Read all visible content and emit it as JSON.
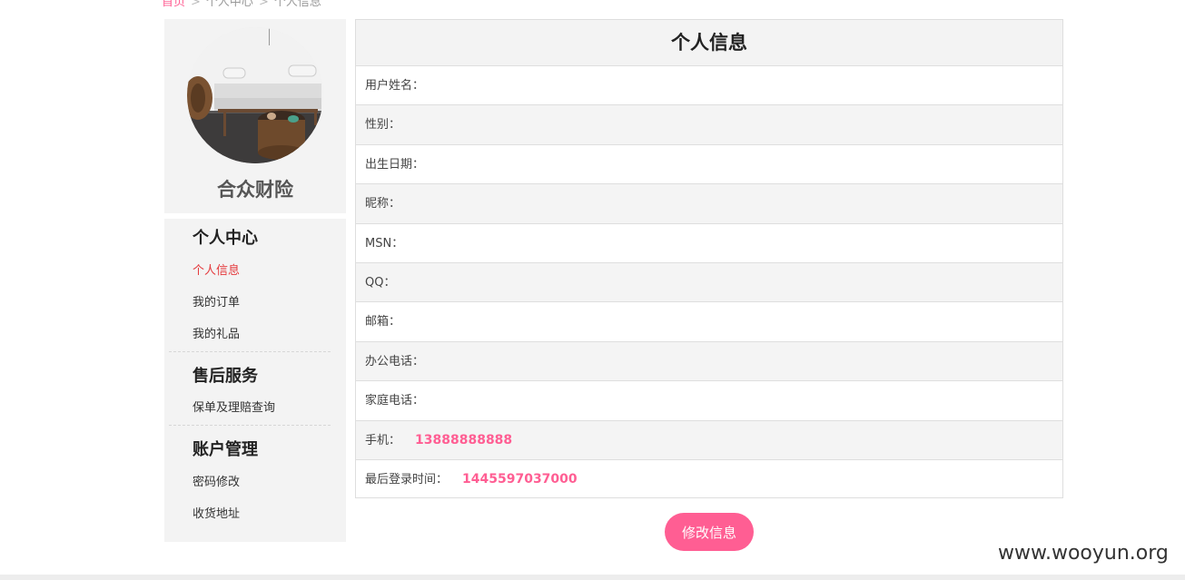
{
  "breadcrumb": {
    "items": [
      "首页",
      "个人中心",
      "个人信息"
    ],
    "separator": ">"
  },
  "profile": {
    "company_name": "合众财险",
    "avatar_icon": "sofa-room-photo"
  },
  "menu": {
    "sections": [
      {
        "title": "个人中心",
        "items": [
          "个人信息",
          "我的订单",
          "我的礼品"
        ]
      },
      {
        "title": "售后服务",
        "items": [
          "保单及理赔查询"
        ]
      },
      {
        "title": "账户管理",
        "items": [
          "密码修改",
          "收货地址"
        ]
      }
    ],
    "active_item": "个人信息"
  },
  "info": {
    "title": "个人信息",
    "rows": [
      {
        "label": "用户姓名：",
        "value": ""
      },
      {
        "label": "性别：",
        "value": ""
      },
      {
        "label": "出生日期：",
        "value": ""
      },
      {
        "label": "昵称：",
        "value": ""
      },
      {
        "label": "MSN：",
        "value": ""
      },
      {
        "label": "QQ：",
        "value": ""
      },
      {
        "label": "邮箱：",
        "value": ""
      },
      {
        "label": "办公电话：",
        "value": ""
      },
      {
        "label": "家庭电话：",
        "value": ""
      },
      {
        "label": "手机：",
        "value": "13888888888"
      },
      {
        "label": "最后登录时间：",
        "value": "1445597037000"
      }
    ]
  },
  "actions": {
    "edit_label": "修改信息"
  },
  "watermark": "www.wooyun.org",
  "colors": {
    "accent": "#ff5e93",
    "active_menu": "#e4393c"
  }
}
